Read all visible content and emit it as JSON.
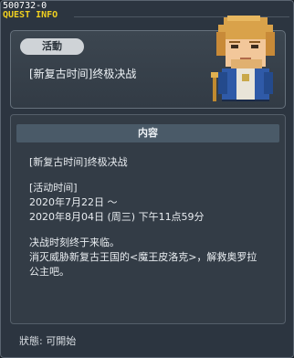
{
  "window": {
    "id_label": "500732-0",
    "title": "QUEST INFO"
  },
  "quest": {
    "badge": "活動",
    "name": "[新复古时间]终极决战"
  },
  "content": {
    "header": "内容",
    "title_line": "[新复古时间]终极决战",
    "time_label": "[活动时间]",
    "start": "2020年7月22日 ～",
    "end": "2020年8月04日 (周三) 下午11点59分",
    "desc1": "决战时刻终于来临。",
    "desc2": "消灭威胁新复古王国的<魔王皮洛克>，解救奥罗拉",
    "desc3": "公主吧。"
  },
  "status": {
    "text": "狀態: 可開始"
  },
  "icons": {
    "portrait": "npc-portrait-icon"
  }
}
